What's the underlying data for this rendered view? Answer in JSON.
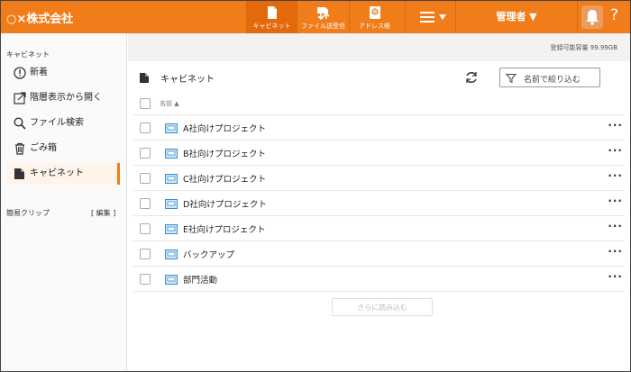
{
  "header": {
    "brand": "○×株式会社",
    "nav": [
      {
        "label": "キャビネット",
        "icon": "cabinet-icon",
        "active": true
      },
      {
        "label": "ファイル送受信",
        "icon": "file-transfer-icon",
        "active": false
      },
      {
        "label": "アドレス帳",
        "icon": "address-book-icon",
        "active": false
      }
    ],
    "user_label": "管理者 ▼",
    "help": "?",
    "colors": {
      "accent": "#f07d1a"
    }
  },
  "sidebar": {
    "title": "キャビネット",
    "items": [
      {
        "label": "新着",
        "icon": "alert-circle-icon",
        "active": false
      },
      {
        "label": "階層表示から開く",
        "icon": "external-link-icon",
        "active": false
      },
      {
        "label": "ファイル検索",
        "icon": "search-icon",
        "active": false
      },
      {
        "label": "ごみ箱",
        "icon": "trash-icon",
        "active": false
      },
      {
        "label": "キャビネット",
        "icon": "cabinet-icon",
        "active": true
      }
    ],
    "clip_title": "簡易クリップ",
    "clip_edit": "[ 編集 ]"
  },
  "main": {
    "quota": "登録可能容量 99.99GB",
    "breadcrumb": "キャビネット",
    "filter_placeholder": "名前で絞り込む",
    "column_name": "名前 ▲",
    "rows": [
      {
        "name": "A社向けプロジェクト"
      },
      {
        "name": "B社向けプロジェクト"
      },
      {
        "name": "C社向けプロジェクト"
      },
      {
        "name": "D社向けプロジェクト"
      },
      {
        "name": "E社向けプロジェクト"
      },
      {
        "name": "バックアップ"
      },
      {
        "name": "部門活動"
      }
    ],
    "more": "···",
    "load_more": "さらに読み込む"
  }
}
